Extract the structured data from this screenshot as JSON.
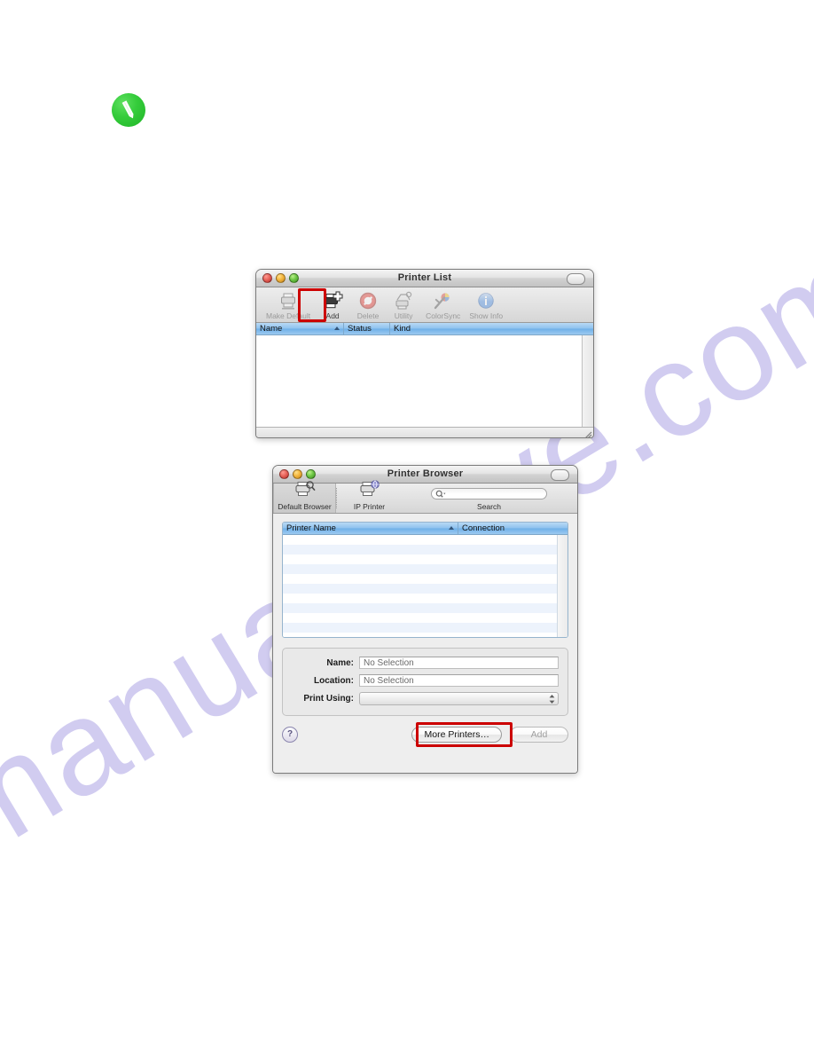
{
  "page": {
    "watermark": "manualshive.com",
    "watermark_color": "#c9c4ee",
    "background": "#ffffff",
    "note_icon": "green-pencil-note-icon"
  },
  "printer_list_window": {
    "title": "Printer List",
    "window_controls": {
      "close": "close-button",
      "minimize": "minimize-button",
      "zoom": "zoom-button",
      "toolbar_toggle": "toolbar-toggle-button"
    },
    "toolbar": [
      {
        "label": "Make Default",
        "icon": "printer-default-icon",
        "enabled": false
      },
      {
        "label": "Add",
        "icon": "printer-add-icon",
        "enabled": true,
        "highlighted": true
      },
      {
        "label": "Delete",
        "icon": "delete-prohibit-icon",
        "enabled": false
      },
      {
        "label": "Utility",
        "icon": "utility-printer-icon",
        "enabled": false
      },
      {
        "label": "ColorSync",
        "icon": "colorsync-icon",
        "enabled": false
      },
      {
        "label": "Show Info",
        "icon": "info-circle-icon",
        "enabled": false
      }
    ],
    "columns": [
      {
        "label": "Name",
        "sorted": true
      },
      {
        "label": "Status",
        "sorted": false
      },
      {
        "label": "Kind",
        "sorted": false
      }
    ],
    "rows": []
  },
  "printer_browser_window": {
    "title": "Printer Browser",
    "window_controls": {
      "close": "close-button",
      "minimize": "minimize-button",
      "zoom": "zoom-button",
      "toolbar_toggle": "toolbar-toggle-button"
    },
    "tabs": [
      {
        "label": "Default Browser",
        "icon": "printer-browse-icon",
        "selected": true
      },
      {
        "label": "IP Printer",
        "icon": "printer-ip-icon",
        "selected": false
      }
    ],
    "search": {
      "value": "",
      "placeholder": "",
      "label": "Search",
      "icon": "search-magnifier-icon"
    },
    "list": {
      "columns": [
        {
          "label": "Printer Name",
          "sorted": true
        },
        {
          "label": "Connection",
          "sorted": false
        }
      ],
      "rows": []
    },
    "fields": [
      {
        "label": "Name:",
        "value": "No Selection",
        "type": "text"
      },
      {
        "label": "Location:",
        "value": "No Selection",
        "type": "text"
      },
      {
        "label": "Print Using:",
        "value": "",
        "type": "popup"
      }
    ],
    "buttons": {
      "help": "?",
      "more_printers": "More Printers…",
      "more_printers_highlighted": true,
      "add": "Add",
      "add_enabled": false
    }
  },
  "callout_color": "#cc0000"
}
